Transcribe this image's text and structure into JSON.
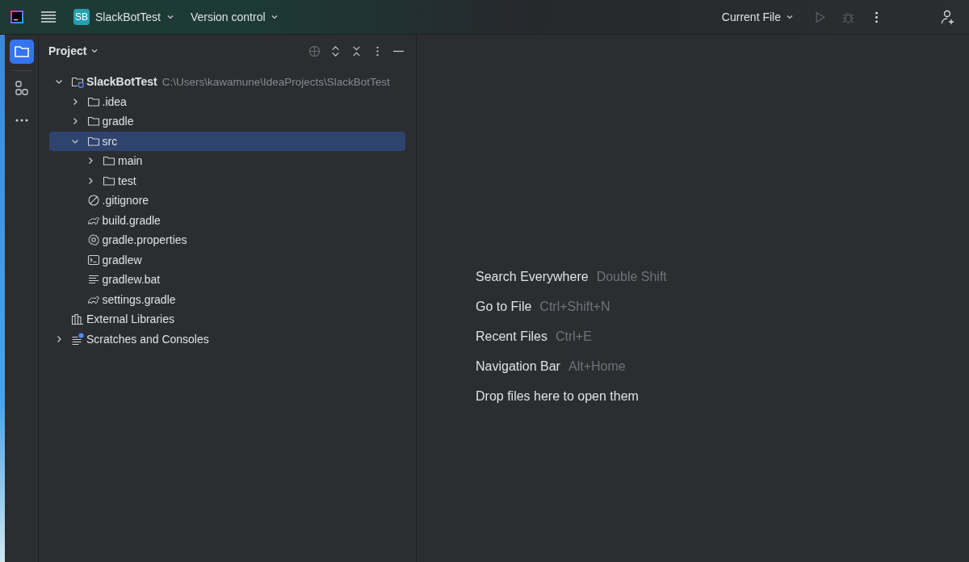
{
  "title_bar": {
    "project_badge": "SB",
    "project_name": "SlackBotTest",
    "vcs_menu": "Version control",
    "run_config": "Current File"
  },
  "tool_window": {
    "title": "Project"
  },
  "tree": [
    {
      "label": "SlackBotTest",
      "path": "C:\\Users\\kawamune\\IdeaProjects\\SlackBotTest",
      "kind": "module",
      "expanded": true,
      "selected": false,
      "children": [
        {
          "label": ".idea",
          "kind": "folder",
          "expanded": false,
          "selected": false
        },
        {
          "label": "gradle",
          "kind": "folder",
          "expanded": false,
          "selected": false
        },
        {
          "label": "src",
          "kind": "folder",
          "expanded": true,
          "selected": true,
          "children": [
            {
              "label": "main",
              "kind": "folder",
              "expanded": false,
              "selected": false
            },
            {
              "label": "test",
              "kind": "folder",
              "expanded": false,
              "selected": false
            }
          ]
        },
        {
          "label": ".gitignore",
          "kind": "ignore",
          "selected": false
        },
        {
          "label": "build.gradle",
          "kind": "gradle",
          "selected": false
        },
        {
          "label": "gradle.properties",
          "kind": "settings",
          "selected": false
        },
        {
          "label": "gradlew",
          "kind": "script",
          "selected": false
        },
        {
          "label": "gradlew.bat",
          "kind": "text",
          "selected": false
        },
        {
          "label": "settings.gradle",
          "kind": "gradle",
          "selected": false
        }
      ]
    },
    {
      "label": "External Libraries",
      "kind": "libraries",
      "selected": false
    },
    {
      "label": "Scratches and Consoles",
      "kind": "scratches",
      "expanded": false,
      "selected": false
    }
  ],
  "editor_hints": [
    {
      "action": "Search Everywhere",
      "shortcut": "Double Shift"
    },
    {
      "action": "Go to File",
      "shortcut": "Ctrl+Shift+N"
    },
    {
      "action": "Recent Files",
      "shortcut": "Ctrl+E"
    },
    {
      "action": "Navigation Bar",
      "shortcut": "Alt+Home"
    },
    {
      "action": "Drop files here to open them"
    }
  ]
}
